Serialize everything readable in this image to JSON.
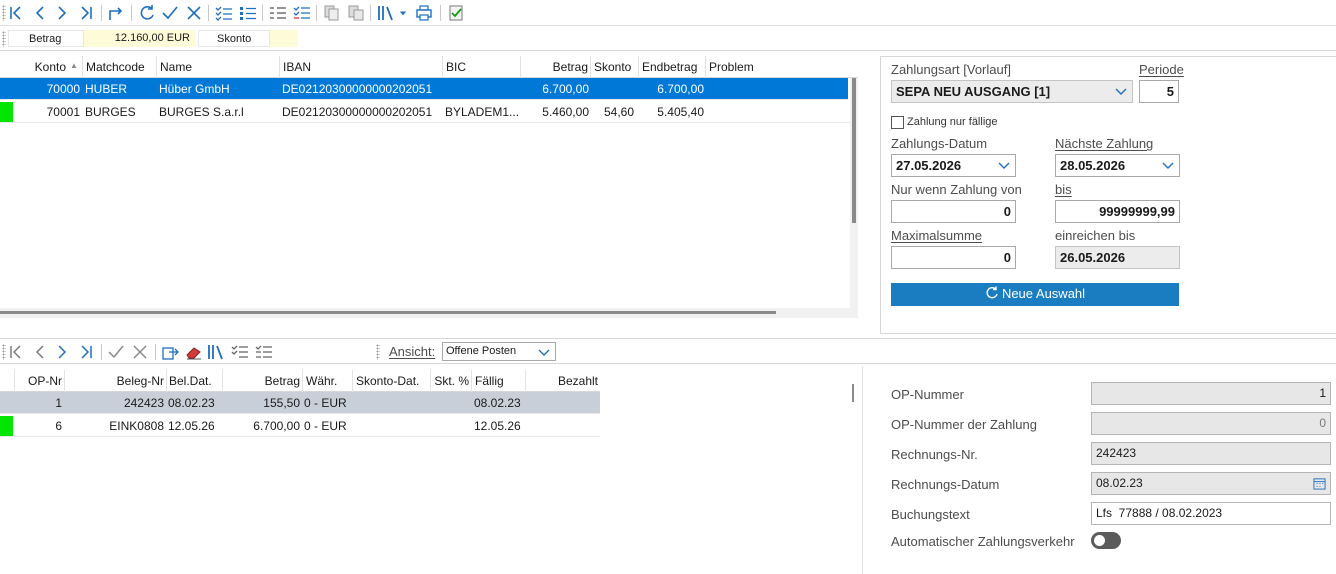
{
  "colors": {
    "accent": "#0078d7",
    "button_blue": "#1a7cc1",
    "marker_green": "#00e600",
    "value_yellow": "#fdfbd8"
  },
  "summary": {
    "betrag_label": "Betrag",
    "betrag_value": "12.160,00 EUR",
    "skonto_label": "Skonto",
    "skonto_value": ""
  },
  "top_grid": {
    "headers": [
      "Konto",
      "Matchcode",
      "Name",
      "IBAN",
      "BIC",
      "Betrag",
      "Skonto",
      "Endbetrag",
      "Problem"
    ],
    "sort_indicator": "▲",
    "rows": [
      {
        "konto": "70000",
        "matchcode": "HUBER",
        "name": "Hüber GmbH",
        "iban": "DE02120300000000202051",
        "bic": "",
        "betrag": "6.700,00",
        "skonto": "",
        "endbetrag": "6.700,00",
        "problem": ""
      },
      {
        "konto": "70001",
        "matchcode": "BURGES",
        "name": "BURGES S.a.r.l",
        "iban": "DE02120300000000202051",
        "bic": "BYLADEM1...",
        "betrag": "5.460,00",
        "skonto": "54,60",
        "endbetrag": "5.405,40",
        "problem": ""
      }
    ]
  },
  "payment_form": {
    "zahlungsart_label": "Zahlungsart [Vorlauf]",
    "zahlungsart_value": "SEPA NEU AUSGANG [1]",
    "periode_label": "Periode",
    "periode_value": "5",
    "nur_faellige_label": "Zahlung nur fällige",
    "zahlungs_datum_label": "Zahlungs-Datum",
    "zahlungs_datum_value": "27.05.2026",
    "naechste_zahlung_label": "Nächste Zahlung",
    "naechste_zahlung_value": "28.05.2026",
    "nur_wenn_label": "Nur wenn Zahlung von",
    "nur_wenn_value": "0",
    "bis_label": "bis",
    "bis_value": "99999999,99",
    "maximalsumme_label": "Maximalsumme",
    "maximalsumme_value": "0",
    "einreichen_label": "einreichen bis",
    "einreichen_value": "26.05.2026",
    "neue_auswahl_label": "Neue Auswahl"
  },
  "lower_toolbar": {
    "ansicht_label": "Ansicht:",
    "ansicht_value": "Offene Posten"
  },
  "bottom_grid": {
    "headers": [
      "OP-Nr",
      "Beleg-Nr",
      "Bel.Dat.",
      "Betrag",
      "Währ.",
      "Skonto-Dat.",
      "Skt. %",
      "Fällig",
      "Bezahlt"
    ],
    "rows": [
      {
        "op_nr": "1",
        "beleg_nr": "242423",
        "bel_dat": "08.02.23",
        "betrag": "155,50",
        "waehr": "0 - EUR",
        "skonto_dat": "",
        "skt": "",
        "faellig": "08.02.23",
        "bezahlt": ""
      },
      {
        "op_nr": "6",
        "beleg_nr": "EINK0808",
        "bel_dat": "12.05.26",
        "betrag": "6.700,00",
        "waehr": "0 - EUR",
        "skonto_dat": "",
        "skt": "",
        "faellig": "12.05.26",
        "bezahlt": ""
      }
    ]
  },
  "details": {
    "op_nummer_label": "OP-Nummer",
    "op_nummer_value": "1",
    "op_nummer_zahlung_label": "OP-Nummer der Zahlung",
    "op_nummer_zahlung_value": "0",
    "rechnungs_nr_label": "Rechnungs-Nr.",
    "rechnungs_nr_value": "242423",
    "rechnungs_datum_label": "Rechnungs-Datum",
    "rechnungs_datum_value": "08.02.23",
    "buchungstext_label": "Buchungstext",
    "buchungstext_value": "Lfs  77888 / 08.02.2023",
    "auto_zahlungsverkehr_label": "Automatischer Zahlungsverkehr",
    "auto_zahlungsverkehr_on": false
  }
}
